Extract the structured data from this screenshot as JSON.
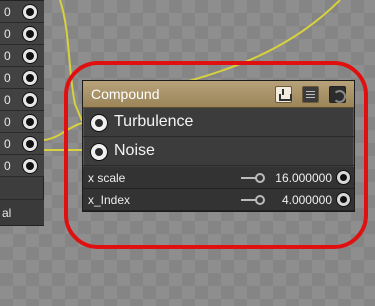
{
  "left_node": {
    "rows": [
      "0",
      "0",
      "0",
      "0",
      "0",
      "0",
      "0",
      "0"
    ],
    "footer": "al"
  },
  "node": {
    "title": "Compound",
    "header_icons": [
      "export-icon",
      "list-icon",
      "refresh-icon"
    ],
    "inputs": [
      {
        "label": "Turbulence",
        "icon": "target-icon"
      },
      {
        "label": "Noise",
        "icon": "target-icon"
      }
    ],
    "params": [
      {
        "name": "x scale",
        "value": "16.000000",
        "icon": "key-icon"
      },
      {
        "name": "x_Index",
        "value": "4.000000",
        "icon": "key-icon"
      }
    ]
  },
  "colors": {
    "header": "#a48e62",
    "wire": "#d8d23a",
    "highlight": "#e01010",
    "node_body": "#3c3c3c"
  }
}
